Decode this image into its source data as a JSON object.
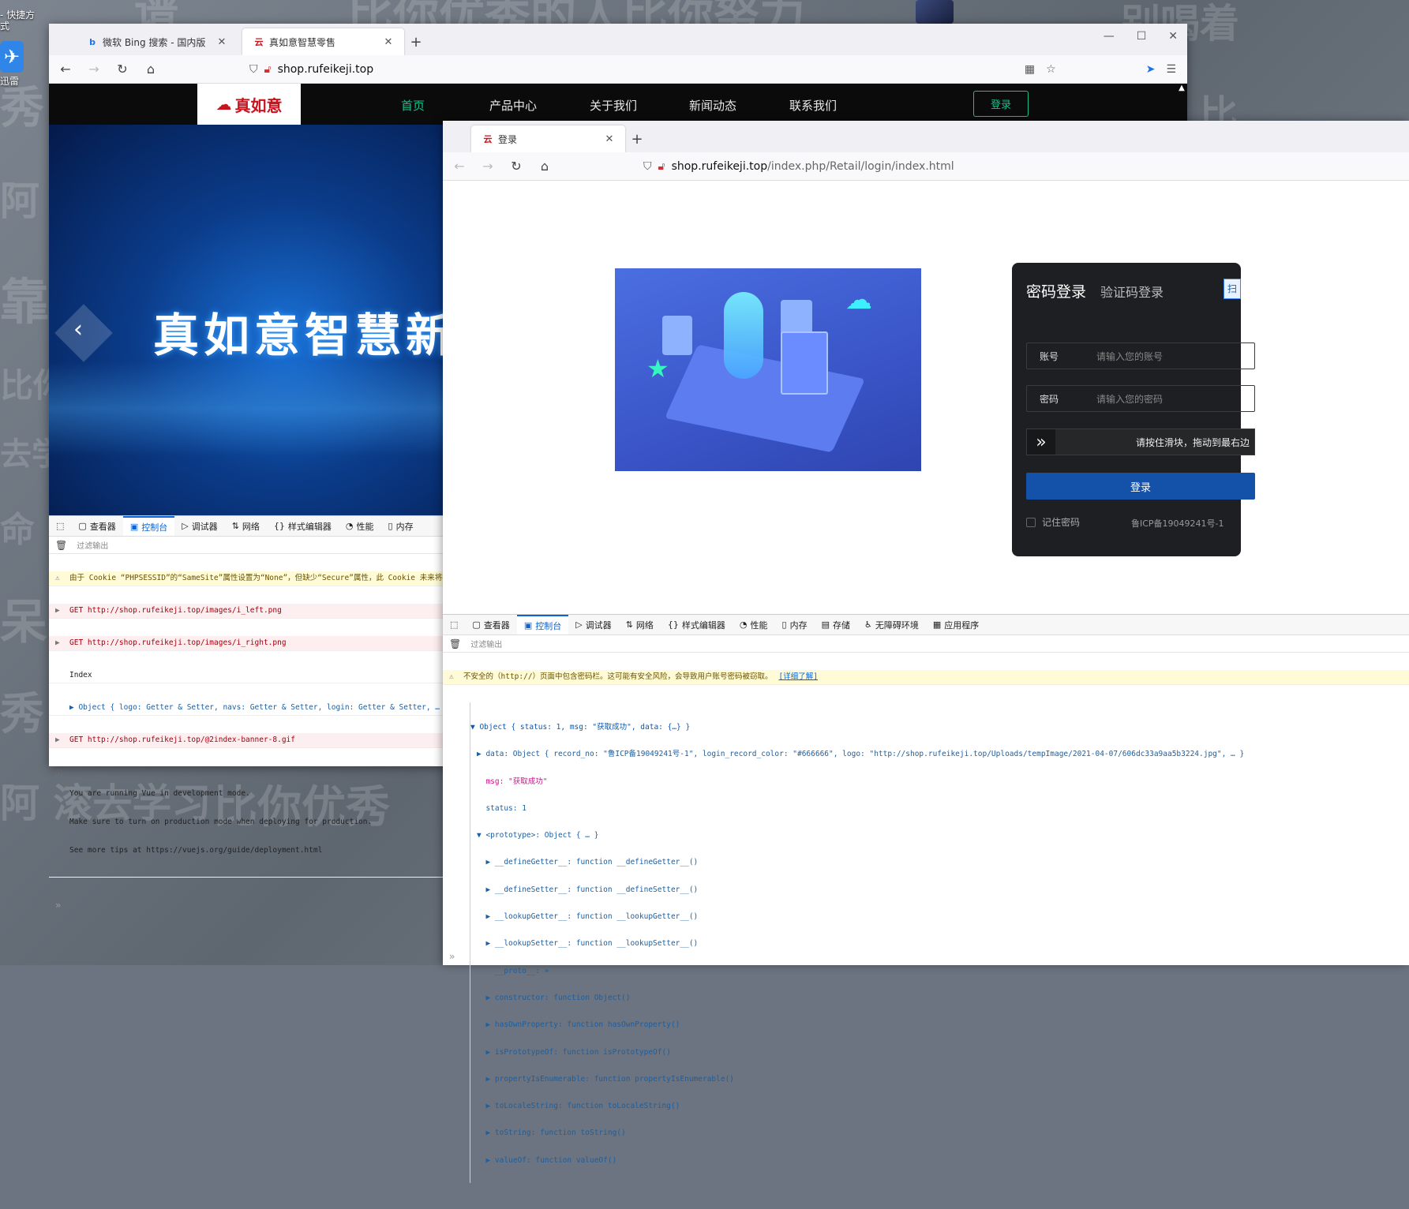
{
  "desktop": {
    "shortcut_labels": [
      "- 快捷方",
      "式",
      "迅雷"
    ],
    "watermarks": [
      "秀",
      "阿 滚",
      "靠",
      "比你",
      "去学",
      "命",
      "呆啊",
      "秀",
      "阿 滚去学习",
      "比你优秀",
      "比你优秀的人比你努力",
      "别喝着",
      "比",
      "谱"
    ]
  },
  "main_window": {
    "tabs": [
      {
        "title": "微软 Bing 搜索 - 国内版",
        "favicon": "b"
      },
      {
        "title": "真如意智慧零售",
        "favicon": "云"
      }
    ],
    "new_tab": "+",
    "controls": {
      "minimize": "—",
      "maximize": "☐",
      "close": "✕"
    },
    "url": {
      "host": "shop.rufeikeji.top",
      "prefix": ""
    },
    "site": {
      "logo_text": "真如意",
      "nav": [
        "首页",
        "产品中心",
        "关于我们",
        "新闻动态",
        "联系我们"
      ],
      "login": "登录",
      "banner_title": "真如意智慧新"
    },
    "devtools": {
      "tabs": [
        "查看器",
        "控制台",
        "调试器",
        "网络",
        "样式编辑器",
        "性能",
        "内存"
      ],
      "filter": "过滤输出",
      "messages": [
        {
          "type": "warn",
          "text": "由于 Cookie “PHPSESSID”的“SameSite”属性设置为“None”，但缺少“Secure”属性，此 Cookie 未来将被拒"
        },
        {
          "type": "err",
          "text": "GET http://shop.rufeikeji.top/images/i_left.png"
        },
        {
          "type": "err",
          "text": "GET http://shop.rufeikeji.top/images/i_right.png"
        },
        {
          "type": "log",
          "text": "Index"
        },
        {
          "type": "log",
          "text": "▶ Object { logo: Getter & Setter, navs: Getter & Setter, login: Getter & Setter, … }"
        },
        {
          "type": "err",
          "text": "GET http://shop.rufeikeji.top/@2index-banner-8.gif"
        }
      ],
      "vue_info": [
        "You are running Vue in development mode.",
        "Make sure to turn on production mode when deploying for production.",
        "See more tips at https://vuejs.org/guide/deployment.html"
      ],
      "prompt": "»"
    }
  },
  "second_window": {
    "tab": {
      "title": "登录",
      "favicon": "云"
    },
    "new_tab": "+",
    "url": {
      "host": "shop.rufeikeji.top",
      "path": "/index.php/Retail/login/index.html"
    },
    "login": {
      "tab_active": "密码登录",
      "tab_other": "验证码登录",
      "corner_btn": "扫",
      "account_label": "账号",
      "account_placeholder": "请输入您的账号",
      "password_label": "密码",
      "password_placeholder": "请输入您的密码",
      "slider_text": "请按住滑块，拖动到最右边",
      "submit": "登录",
      "remember": "记住密码"
    },
    "icp": "鲁ICP备19049241号-1",
    "devtools": {
      "tabs": [
        "查看器",
        "控制台",
        "调试器",
        "网络",
        "样式编辑器",
        "性能",
        "内存",
        "存储",
        "无障碍环境",
        "应用程序"
      ],
      "filter": "过滤输出",
      "warning": "不安全的（http://）页面中包含密码栏。这可能有安全风险，会导致用户账号密码被窃取。",
      "warning_link": "[详细了解]",
      "tree": [
        "▼ Object { status: 1, msg: \"获取成功\", data: {…} }",
        "▶ data: Object { record_no: \"鲁ICP备19049241号-1\", login_record_color: \"#666666\", logo: \"http://shop.rufeikeji.top/Uploads/tempImage/2021-04-07/606dc33a9aa5b3224.jpg\", … }",
        "  msg: \"获取成功\"",
        "  status: 1",
        "▼ <prototype>: Object { … }",
        "  ▶ __defineGetter__: function __defineGetter__()",
        "  ▶ __defineSetter__: function __defineSetter__()",
        "  ▶ __lookupGetter__: function __lookupGetter__()",
        "  ▶ __lookupSetter__: function __lookupSetter__()",
        "    __proto__: »",
        "  ▶ constructor: function Object()",
        "  ▶ hasOwnProperty: function hasOwnProperty()",
        "  ▶ isPrototypeOf: function isPrototypeOf()",
        "  ▶ propertyIsEnumerable: function propertyIsEnumerable()",
        "  ▶ toLocaleString: function toLocaleString()",
        "  ▶ toString: function toString()",
        "  ▶ valueOf: function valueOf()"
      ],
      "prompt": "»"
    }
  },
  "colors": {
    "accent": "#18c08f",
    "link": "#0a64d8",
    "login_btn": "#1451a8",
    "panel": "#1e1f22"
  }
}
